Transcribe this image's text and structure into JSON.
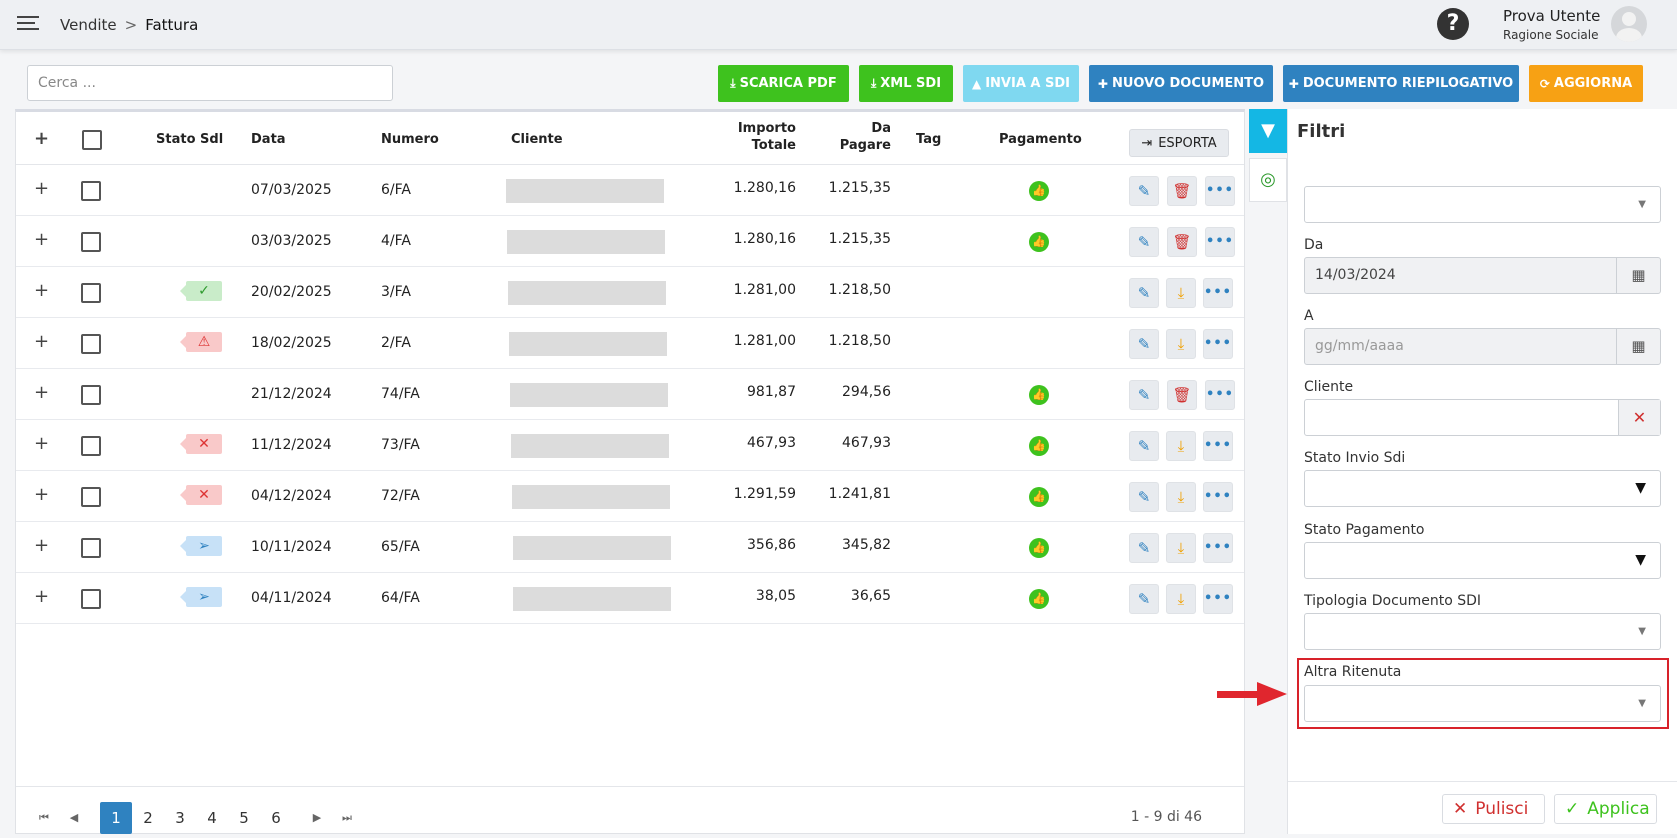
{
  "header": {
    "breadcrumb_parent": "Vendite",
    "breadcrumb_sep": ">",
    "breadcrumb_current": "Fattura",
    "help_glyph": "?",
    "user_name": "Prova Utente",
    "user_company": "Ragione Sociale"
  },
  "toolbar": {
    "search_placeholder": "Cerca ...",
    "buttons": {
      "scarica_pdf": "SCARICA PDF",
      "xml_sdi": "XML SDI",
      "invia_sdi": "INVIA A SDI",
      "nuovo_documento": "NUOVO DOCUMENTO",
      "documento_riepilogativo": "DOCUMENTO RIEPILOGATIVO",
      "aggiorna": "AGGIORNA"
    }
  },
  "table": {
    "headers": {
      "stato_sdi": "Stato Sdl",
      "data": "Data",
      "numero": "Numero",
      "cliente": "Cliente",
      "importo_l1": "Importo",
      "importo_l2": "Totale",
      "pagare_l1": "Da",
      "pagare_l2": "Pagare",
      "tag": "Tag",
      "pagamento": "Pagamento",
      "esporta": "ESPORTA"
    },
    "rows": [
      {
        "stato": "",
        "data": "07/03/2025",
        "numero": "6/FA",
        "importo": "1.280,16",
        "da_pagare": "1.215,35",
        "pagamento": true,
        "deletable": true
      },
      {
        "stato": "",
        "data": "03/03/2025",
        "numero": "4/FA",
        "importo": "1.280,16",
        "da_pagare": "1.215,35",
        "pagamento": true,
        "deletable": true
      },
      {
        "stato": "ok",
        "data": "20/02/2025",
        "numero": "3/FA",
        "importo": "1.281,00",
        "da_pagare": "1.218,50",
        "pagamento": false,
        "deletable": false
      },
      {
        "stato": "warning",
        "data": "18/02/2025",
        "numero": "2/FA",
        "importo": "1.281,00",
        "da_pagare": "1.218,50",
        "pagamento": false,
        "deletable": false
      },
      {
        "stato": "",
        "data": "21/12/2024",
        "numero": "74/FA",
        "importo": "981,87",
        "da_pagare": "294,56",
        "pagamento": true,
        "deletable": true
      },
      {
        "stato": "rejected",
        "data": "11/12/2024",
        "numero": "73/FA",
        "importo": "467,93",
        "da_pagare": "467,93",
        "pagamento": true,
        "deletable": false
      },
      {
        "stato": "rejected",
        "data": "04/12/2024",
        "numero": "72/FA",
        "importo": "1.291,59",
        "da_pagare": "1.241,81",
        "pagamento": true,
        "deletable": false
      },
      {
        "stato": "sent",
        "data": "10/11/2024",
        "numero": "65/FA",
        "importo": "356,86",
        "da_pagare": "345,82",
        "pagamento": true,
        "deletable": false
      },
      {
        "stato": "sent",
        "data": "04/11/2024",
        "numero": "64/FA",
        "importo": "38,05",
        "da_pagare": "36,65",
        "pagamento": true,
        "deletable": false
      }
    ]
  },
  "pagination": {
    "pages": [
      "1",
      "2",
      "3",
      "4",
      "5",
      "6"
    ],
    "active": "1",
    "info": "1 - 9 di 46"
  },
  "filters": {
    "title": "Filtri",
    "da_label": "Da",
    "da_value": "14/03/2024",
    "a_label": "A",
    "a_placeholder": "gg/mm/aaaa",
    "cliente_label": "Cliente",
    "stato_invio_label": "Stato Invio Sdi",
    "stato_pagamento_label": "Stato Pagamento",
    "tipologia_label": "Tipologia Documento SDI",
    "altra_ritenuta_label": "Altra Ritenuta",
    "pulisci": "Pulisci",
    "applica": "Applica"
  },
  "colors": {
    "green": "#3ec21e",
    "blue": "#2f82c0",
    "lightblue": "#7fd8f0",
    "orange": "#f7a114",
    "highlight": "#d8222a"
  }
}
